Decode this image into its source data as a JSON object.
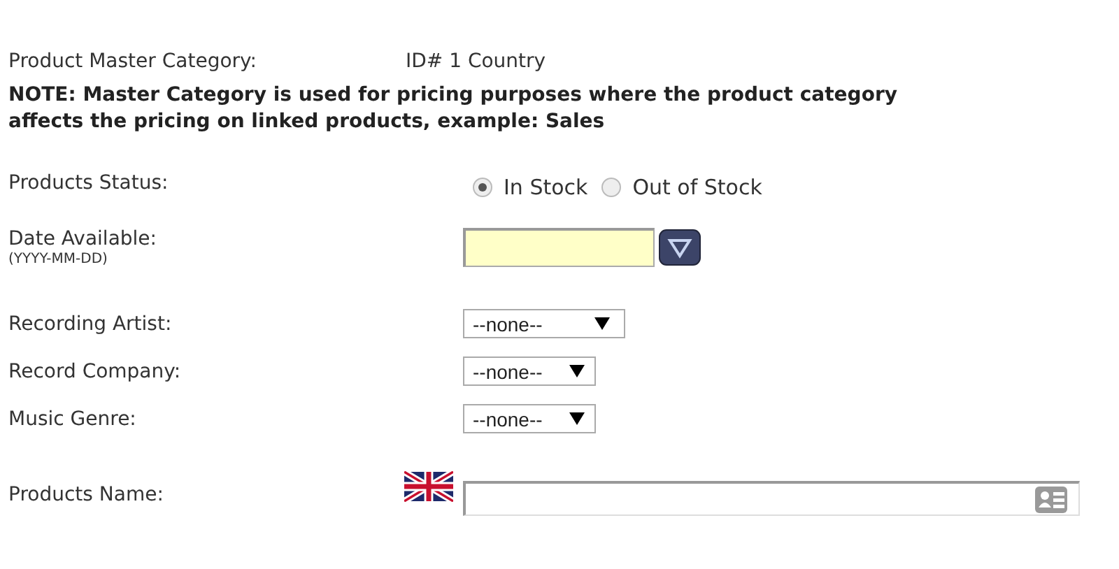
{
  "master_category": {
    "label": "Product Master Category:",
    "value": "ID# 1 Country"
  },
  "note": "NOTE: Master Category is used for pricing purposes where the product category affects the pricing on linked products, example: Sales",
  "status": {
    "label": "Products Status:",
    "options": [
      {
        "label": "In Stock",
        "selected": true
      },
      {
        "label": "Out of Stock",
        "selected": false
      }
    ]
  },
  "date_available": {
    "label": "Date Available:",
    "hint": "(YYYY-MM-DD)"
  },
  "selects": [
    {
      "label": "Recording Artist:",
      "value": "--none--",
      "wide": true
    },
    {
      "label": "Record Company:",
      "value": "--none--",
      "wide": false
    },
    {
      "label": "Music Genre:",
      "value": "--none--",
      "wide": false
    }
  ],
  "products_name": {
    "label": "Products Name:"
  }
}
